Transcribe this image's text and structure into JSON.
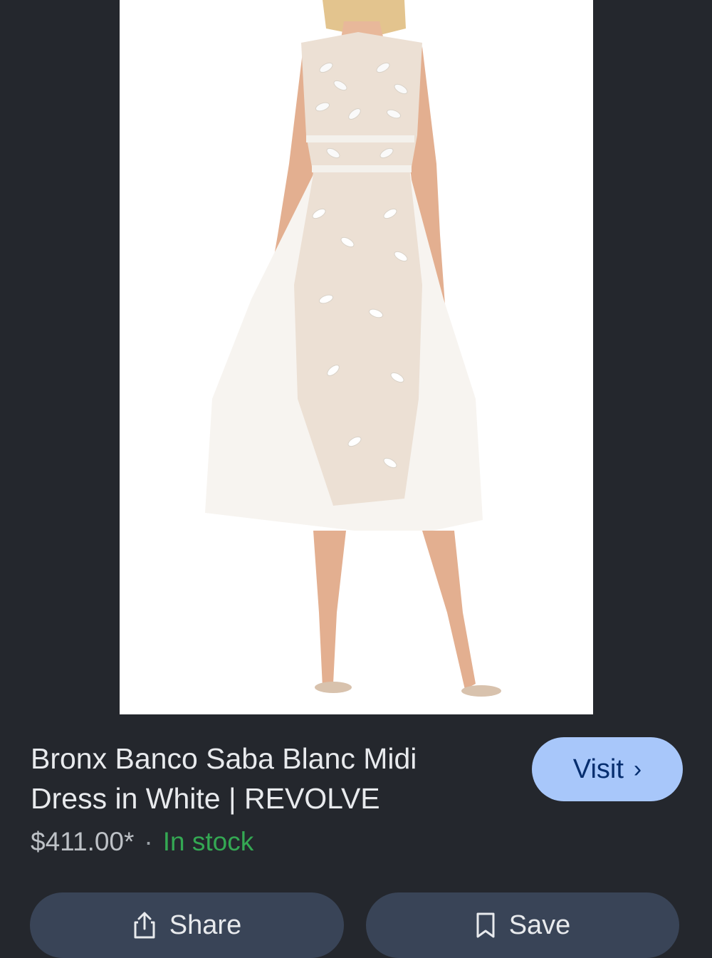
{
  "product": {
    "title": "Bronx Banco Saba Blanc Midi Dress in White | REVOLVE",
    "price": "$411.00*",
    "separator": "·",
    "stock_status": "In stock"
  },
  "actions": {
    "visit_label": "Visit",
    "share_label": "Share",
    "save_label": "Save"
  },
  "icons": {
    "visit": "chevron-right-icon",
    "share": "share-icon",
    "save": "bookmark-icon"
  },
  "colors": {
    "background": "#24272d",
    "visit_button": "#a8c7fa",
    "action_button": "#394457",
    "in_stock": "#34a853"
  }
}
